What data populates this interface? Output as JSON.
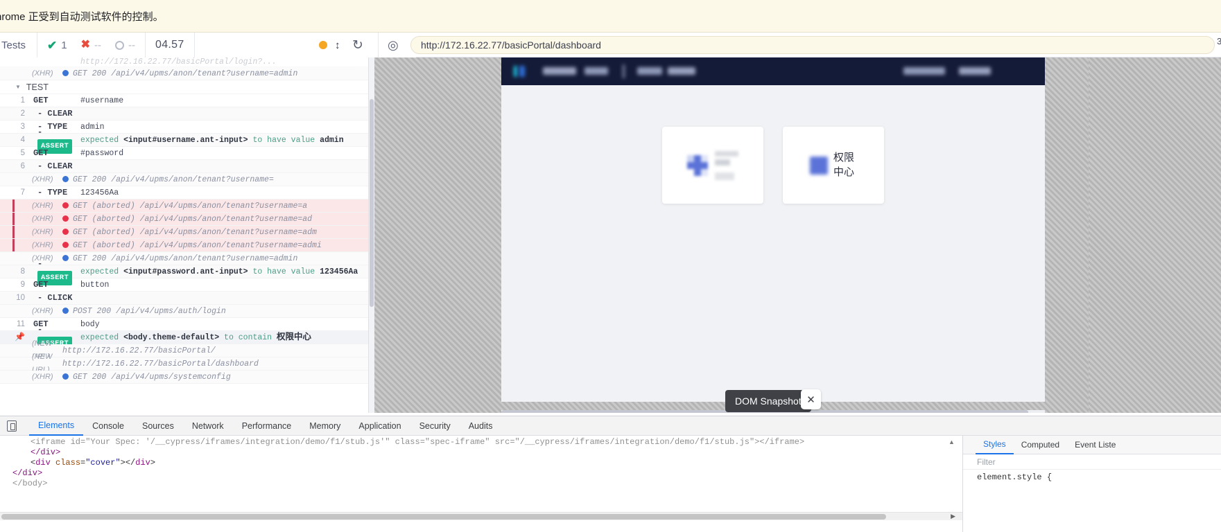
{
  "browser": {
    "automation_notice": "hrome 正受到自动测试软件的控制。",
    "url": "http://172.16.22.77/basicPortal/dashboard",
    "reload_icon": "reload-icon",
    "target_icon": "selector-playground-icon",
    "right_edge_char": "3"
  },
  "cypress_header": {
    "tests_label": "Tests",
    "passed": "1",
    "failed": "--",
    "pending": "--",
    "duration": "04.57",
    "viewport_icon": "viewport-toggle-icon",
    "status_dot": "amber-status-dot"
  },
  "command_log": {
    "suite_label": "TEST",
    "rows": [
      {
        "kind": "clipped",
        "num": "",
        "method": "",
        "msg": "http://172.16.22.77/basicPortal/login?..."
      },
      {
        "kind": "xhr",
        "label": "(XHR)",
        "status": "ok",
        "msg": "GET 200  /api/v4/upms/anon/tenant?username=admin"
      },
      {
        "kind": "suite",
        "label": "TEST"
      },
      {
        "kind": "cmd",
        "num": "1",
        "method": "GET",
        "msg": "#username"
      },
      {
        "kind": "cmd",
        "num": "2",
        "method": "- CLEAR",
        "msg": ""
      },
      {
        "kind": "cmd",
        "num": "3",
        "method": "- TYPE",
        "msg": "admin"
      },
      {
        "kind": "assert",
        "num": "4",
        "method": "-",
        "badge": "ASSERT",
        "pre": "expected ",
        "strong": "<input#username.ant-input>",
        "mid": " to have value ",
        "post": "admin"
      },
      {
        "kind": "cmd",
        "num": "5",
        "method": "GET",
        "msg": "#password"
      },
      {
        "kind": "cmd",
        "num": "6",
        "method": "- CLEAR",
        "msg": ""
      },
      {
        "kind": "xhr",
        "label": "(XHR)",
        "status": "ok",
        "msg": "GET 200  /api/v4/upms/anon/tenant?username="
      },
      {
        "kind": "cmd",
        "num": "7",
        "method": "- TYPE",
        "msg": "123456Aa"
      },
      {
        "kind": "xhr",
        "label": "(XHR)",
        "status": "err",
        "msg": "GET (aborted)  /api/v4/upms/anon/tenant?username=a"
      },
      {
        "kind": "xhr",
        "label": "(XHR)",
        "status": "err",
        "msg": "GET (aborted)  /api/v4/upms/anon/tenant?username=ad"
      },
      {
        "kind": "xhr",
        "label": "(XHR)",
        "status": "err",
        "msg": "GET (aborted)  /api/v4/upms/anon/tenant?username=adm"
      },
      {
        "kind": "xhr",
        "label": "(XHR)",
        "status": "err",
        "msg": "GET (aborted)  /api/v4/upms/anon/tenant?username=admi"
      },
      {
        "kind": "xhr",
        "label": "(XHR)",
        "status": "ok",
        "msg": "GET 200  /api/v4/upms/anon/tenant?username=admin"
      },
      {
        "kind": "assert",
        "num": "8",
        "method": "-",
        "badge": "ASSERT",
        "pre": "expected ",
        "strong": "<input#password.ant-input>",
        "mid": " to have value ",
        "post": "123456Aa"
      },
      {
        "kind": "cmd",
        "num": "9",
        "method": "GET",
        "msg": "button"
      },
      {
        "kind": "cmd",
        "num": "10",
        "method": "- CLICK",
        "msg": ""
      },
      {
        "kind": "xhr",
        "label": "(XHR)",
        "status": "ok",
        "msg": "POST 200  /api/v4/upms/auth/login"
      },
      {
        "kind": "cmd",
        "num": "11",
        "method": "GET",
        "msg": "body"
      },
      {
        "kind": "assert-pinned",
        "num": "pin",
        "method": "-",
        "badge": "ASSERT",
        "pre": "expected ",
        "strong": "<body.theme-default>",
        "mid": " to contain ",
        "post": "权限中心"
      },
      {
        "kind": "newurl",
        "label": "(NEW URL)",
        "msg": "http://172.16.22.77/basicPortal/"
      },
      {
        "kind": "newurl",
        "label": "(NEW URL)",
        "msg": "http://172.16.22.77/basicPortal/dashboard"
      },
      {
        "kind": "xhr",
        "label": "(XHR)",
        "status": "ok",
        "msg": "GET 200  /api/v4/upms/systemconfig"
      }
    ]
  },
  "app_preview": {
    "cards": [
      {
        "label": "",
        "icon": "plus-app-icon",
        "blurred": true
      },
      {
        "label": "权限\n中心",
        "label_line1": "权限",
        "label_line2": "中心",
        "icon": "square-app-icon",
        "blurred": false
      }
    ],
    "dom_snapshot_label": "DOM Snapshot",
    "close_label": "✕"
  },
  "devtools": {
    "tabs": [
      "Elements",
      "Console",
      "Sources",
      "Network",
      "Performance",
      "Memory",
      "Application",
      "Security",
      "Audits"
    ],
    "active_tab": "Elements",
    "inspect_icon": "device-toolbar-icon",
    "dom_lines": [
      "<iframe id=\"Your Spec: '/__cypress/iframes/integration/demo/f1/stub.js'\" class=\"spec-iframe\" src=\"/__cypress/iframes/integration/demo/f1/stub.js\"></iframe>",
      "</div>",
      "<div class=\"cover\"></div>",
      "</div>"
    ],
    "dom_line_2_tag": "div",
    "dom_line_3_attr": "class",
    "dom_line_3_val": "\"cover\"",
    "styles_tabs": [
      "Styles",
      "Computed",
      "Event Liste"
    ],
    "styles_active": "Styles",
    "filter_placeholder": "Filter",
    "element_style": "element.style {"
  },
  "colors": {
    "accent_blue": "#1a73e8",
    "assert_green": "#1cb98a",
    "error_red": "#e8324a",
    "xhr_blue": "#3b74d4",
    "banner_yellow": "#fdf9e9",
    "app_header_navy": "#141b38",
    "card_icon_indigo": "#5b73d8"
  }
}
